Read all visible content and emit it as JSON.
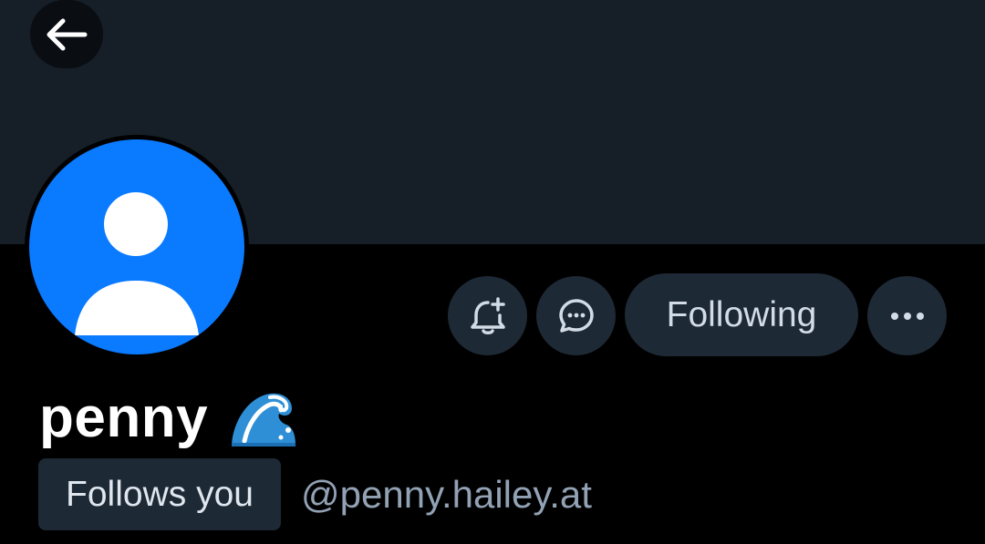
{
  "header": {
    "back_icon": "arrow-left-icon",
    "banner_color": "#161e27"
  },
  "profile": {
    "avatar_icon": "default-user-avatar-icon",
    "avatar_color": "#0a7aff",
    "display_name": "penny",
    "name_emoji": "water-wave-emoji",
    "follows_you_label": "Follows you",
    "handle": "@penny.hailey.at"
  },
  "actions": {
    "notify_icon": "bell-plus-icon",
    "message_icon": "chat-bubble-icon",
    "following_label": "Following",
    "more_icon": "ellipsis-icon"
  }
}
